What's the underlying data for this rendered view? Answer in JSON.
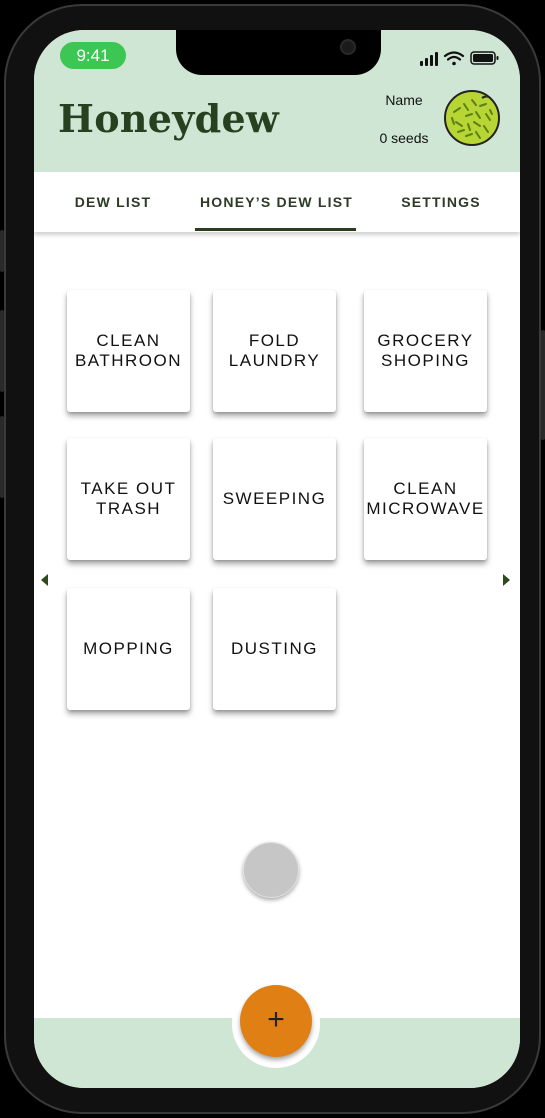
{
  "status_bar": {
    "time": "9:41"
  },
  "header": {
    "title": "Honeydew",
    "user_name": "Name",
    "seeds": "0 seeds"
  },
  "tabs": [
    {
      "label": "DEW LIST"
    },
    {
      "label": "HONEY’S DEW LIST"
    },
    {
      "label": "SETTINGS"
    }
  ],
  "active_tab": "HONEY’S DEW LIST",
  "chores": [
    {
      "label": "CLEAN\nBATHROON"
    },
    {
      "label": "FOLD\nLAUNDRY"
    },
    {
      "label": "GROCERY\nSHOPING"
    },
    {
      "label": "TAKE OUT\nTRASH"
    },
    {
      "label": "SWEEPING"
    },
    {
      "label": "CLEAN\nMICROWAVE"
    },
    {
      "label": "MOPPING"
    },
    {
      "label": "DUSTING"
    }
  ],
  "fab": {
    "label": "+"
  },
  "colors": {
    "header_bg": "#cfe6d5",
    "title_text": "#27401f",
    "fab": "#e07f14",
    "tab_indicator": "#2d3b1f",
    "avatar": "#b7d534"
  }
}
